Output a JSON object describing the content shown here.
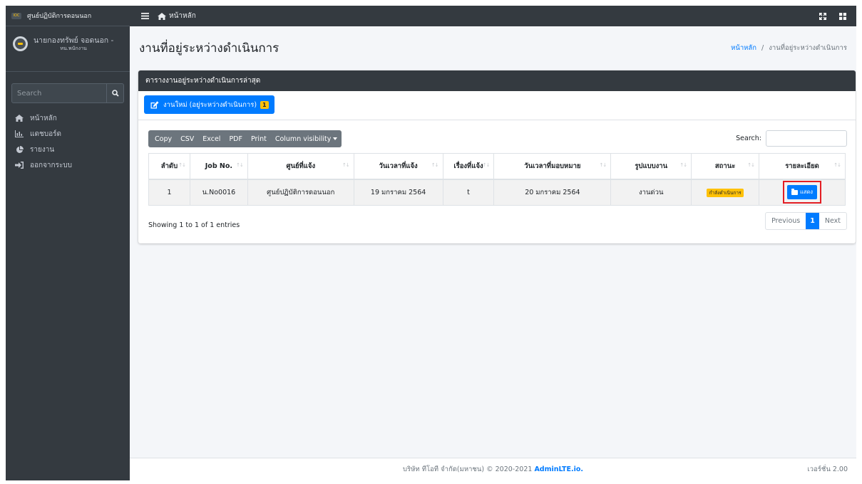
{
  "brand": {
    "name": "ศูนย์ปฏิบัติการดอนนอก",
    "logo_text": "IOC"
  },
  "user": {
    "name": "นายกองทรัพย์ จอดนอก -",
    "role": "หน.พนักงาน"
  },
  "sidebar": {
    "search_placeholder": "Search",
    "items": [
      {
        "label": "หน้าหลัก",
        "icon": "home-icon"
      },
      {
        "label": "แดชบอร์ด",
        "icon": "chart-icon"
      },
      {
        "label": "รายงาน",
        "icon": "pie-chart-icon"
      },
      {
        "label": "ออกจากระบบ",
        "icon": "sign-out-icon"
      }
    ]
  },
  "navbar": {
    "home_label": "หน้าหลัก"
  },
  "header": {
    "title": "งานที่อยู่ระหว่างดำเนินการ",
    "breadcrumb_home": "หน้าหลัก",
    "breadcrumb_sep": "/",
    "breadcrumb_current": "งานที่อยู่ระหว่างดำเนินการ"
  },
  "card": {
    "title": "ตารางงานอยู่ระหว่างดำเนินการล่าสุด",
    "new_button_label": "งานใหม่ (อยู่ระหว่างดำเนินการ)",
    "new_button_badge": "1"
  },
  "toolbar": {
    "buttons": [
      "Copy",
      "CSV",
      "Excel",
      "PDF",
      "Print",
      "Column visibility"
    ],
    "search_label": "Search:"
  },
  "table": {
    "columns": [
      "ลำดับ",
      "Job No.",
      "ศูนย์ที่แจ้ง",
      "วันเวลาที่แจ้ง",
      "เรื่องที่แจ้ง",
      "วันเวลาที่มอบหมาย",
      "รูปแบบงาน",
      "สถานะ",
      "รายละเอียด"
    ],
    "rows": [
      {
        "no": "1",
        "job_no": "น.No0016",
        "center": "ศูนย์ปฏิบัติการดอนนอก",
        "reported_at": "19 มกราคม 2564",
        "subject": "t",
        "assigned_at": "20 มกราคม 2564",
        "job_type": "งานด่วน",
        "status": "กำลังดำเนินการ",
        "detail_label": "แสดง"
      }
    ]
  },
  "info": "Showing 1 to 1 of 1 entries",
  "pagination": {
    "previous": "Previous",
    "current": "1",
    "next": "Next"
  },
  "footer": {
    "copyright": "บริษัท ทีโอที จำกัด(มหาชน) © 2020-2021",
    "link": "AdminLTE.io.",
    "version": "เวอร์ชั่น 2.00"
  },
  "colors": {
    "sidebar": "#343a40",
    "primary": "#007bff",
    "warning": "#ffc107",
    "highlight": "#e31e24"
  }
}
